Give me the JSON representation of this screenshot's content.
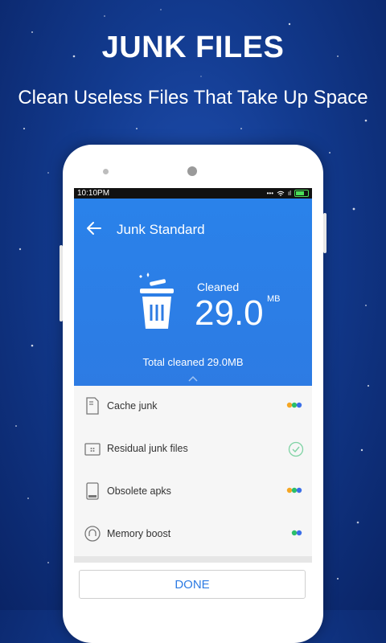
{
  "promo": {
    "title": "JUNK FILES",
    "subtitle": "Clean Useless Files That Take Up Space"
  },
  "statusbar": {
    "time": "10:10PM",
    "signal_dots": "•••",
    "network": "ıl"
  },
  "header": {
    "title": "Junk Standard",
    "back_icon": "back-arrow-icon",
    "cleaned_label": "Cleaned",
    "cleaned_value": "29.0",
    "cleaned_unit": "MB",
    "total_cleaned": "Total cleaned 29.0MB"
  },
  "items": [
    {
      "label": "Cache junk",
      "icon": "file-icon",
      "status": "dots"
    },
    {
      "label": "Residual junk files",
      "icon": "folder-icon",
      "status": "check"
    },
    {
      "label": "Obsolete apks",
      "icon": "apk-icon",
      "status": "dots"
    },
    {
      "label": "Memory boost",
      "icon": "memory-icon",
      "status": "dots-two"
    }
  ],
  "done_label": "DONE",
  "colors": {
    "accent": "#2d7be3",
    "background": "#123a8e",
    "dot_blue": "#3b6fe8",
    "dot_green": "#2bbf6a",
    "dot_orange": "#f5a623",
    "check": "#5fc38a"
  }
}
